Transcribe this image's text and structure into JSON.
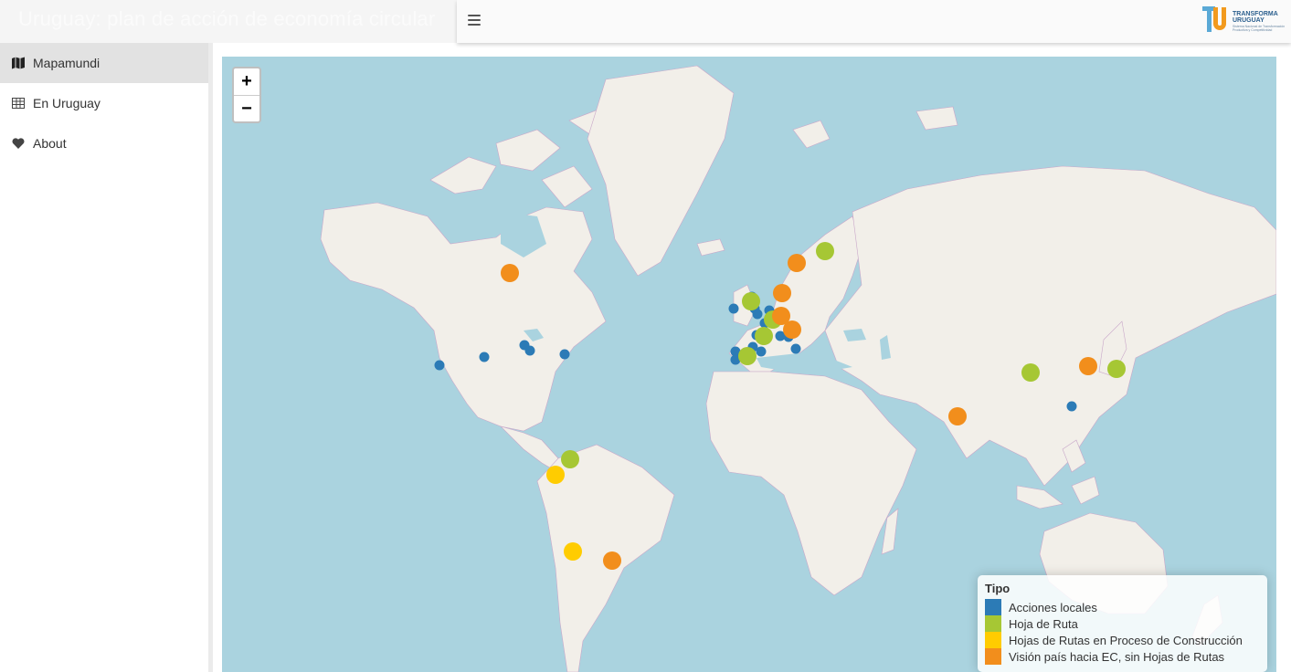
{
  "app": {
    "title": "Uruguay: plan de acción de economía circular"
  },
  "header": {
    "menu_icon": "hamburger-icon"
  },
  "logo": {
    "name": "TRANSFORMA URUGUAY",
    "line1": "TRANSFORMA",
    "line2": "URUGUAY",
    "subtitle": "Sistema Nacional de Transformación Productiva y Competitividad"
  },
  "sidebar": {
    "items": [
      {
        "label": "Mapamundi",
        "icon": "map-icon",
        "active": true
      },
      {
        "label": "En Uruguay",
        "icon": "table-icon",
        "active": false
      },
      {
        "label": "About",
        "icon": "heart-icon",
        "active": false
      }
    ]
  },
  "map": {
    "zoom_in": "+",
    "zoom_out": "−",
    "legend": {
      "title": "Tipo",
      "items": [
        {
          "label": "Acciones locales",
          "color": "#2c7bb6"
        },
        {
          "label": "Hoja de Ruta",
          "color": "#a6c734"
        },
        {
          "label": "Hojas de Rutas en Proceso de Construcción",
          "color": "#ffcc00"
        },
        {
          "label": "Visión país hacia EC, sin Hojas de Rutas",
          "color": "#f28e1c"
        }
      ]
    },
    "colors": {
      "water": "#aad3df",
      "land": "#f2efe9"
    }
  }
}
